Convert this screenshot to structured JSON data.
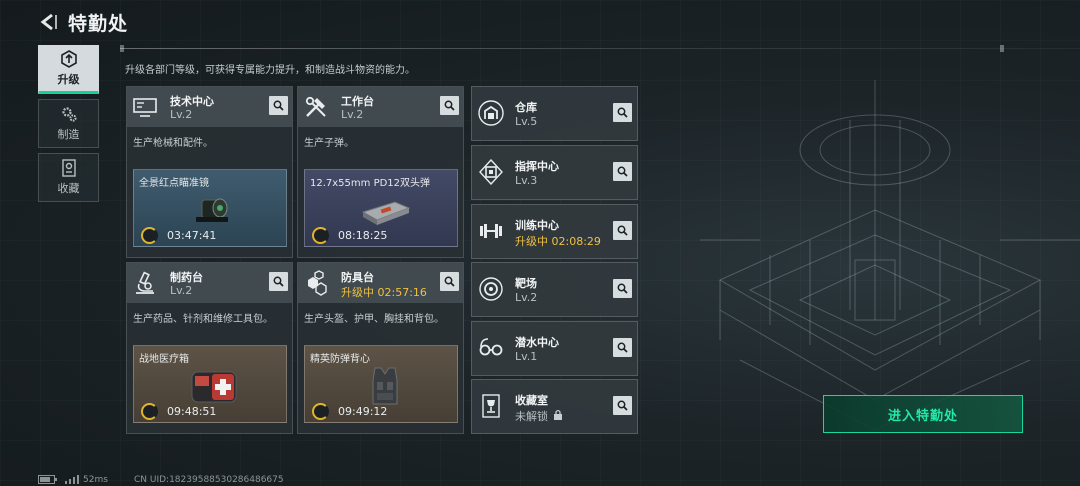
{
  "header": {
    "title": "特勤处"
  },
  "sidenav": [
    {
      "label": "升级",
      "icon": "upgrade-icon",
      "active": true
    },
    {
      "label": "制造",
      "icon": "gear-icon",
      "active": false
    },
    {
      "label": "收藏",
      "icon": "collection-icon",
      "active": false
    }
  ],
  "description": "升级各部门等级，可获得专属能力提升，和制造战斗物资的能力。",
  "cards": [
    {
      "name": "技术中心",
      "level": "Lv.2",
      "desc": "生产枪械和配件。",
      "craft_name": "全景红点瞄准镜",
      "timer": "03:47:41",
      "icon": "computer-icon"
    },
    {
      "name": "工作台",
      "level": "Lv.2",
      "desc": "生产子弹。",
      "craft_name": "12.7x55mm PD12双头弹",
      "timer": "08:18:25",
      "icon": "tools-icon"
    },
    {
      "name": "制药台",
      "level": "Lv.2",
      "desc": "生产药品、针剂和维修工具包。",
      "craft_name": "战地医疗箱",
      "timer": "09:48:51",
      "icon": "microscope-icon"
    },
    {
      "name": "防具台",
      "level": "升级中 02:57:16",
      "desc": "生产头盔、护甲、胸挂和背包。",
      "craft_name": "精英防弹背心",
      "timer": "09:49:12",
      "icon": "armor-icon"
    }
  ],
  "list": [
    {
      "name": "仓库",
      "level": "Lv.5",
      "icon": "warehouse-icon"
    },
    {
      "name": "指挥中心",
      "level": "Lv.3",
      "icon": "chip-icon"
    },
    {
      "name": "训练中心",
      "level": "升级中 02:08:29",
      "icon": "dumbbell-icon"
    },
    {
      "name": "靶场",
      "level": "Lv.2",
      "icon": "target-icon"
    },
    {
      "name": "潜水中心",
      "level": "Lv.1",
      "icon": "goggles-icon"
    },
    {
      "name": "收藏室",
      "level": "未解锁",
      "icon": "trophy-icon"
    }
  ],
  "enter_button": "进入特勤处",
  "footer": {
    "ping": "52ms",
    "uid": "CN UID:18239588530286486675"
  },
  "colors": {
    "accent": "#19d79c",
    "upgrading": "#f0c040"
  }
}
